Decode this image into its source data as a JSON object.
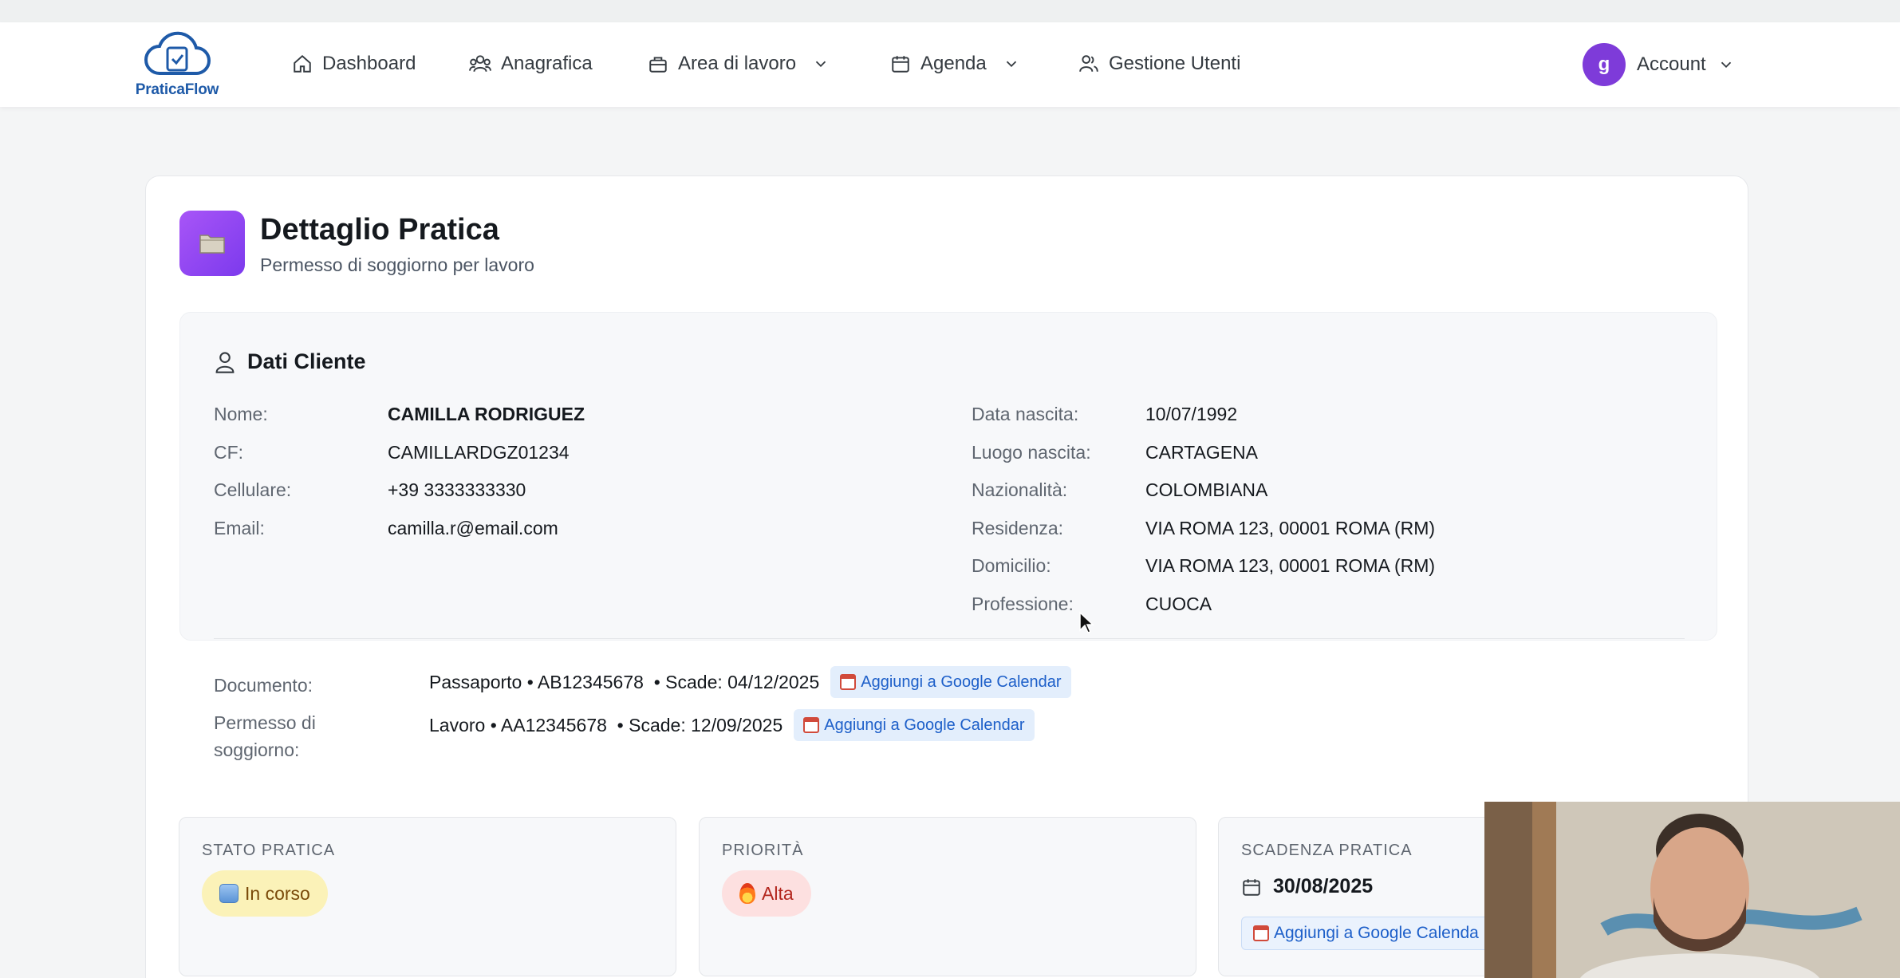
{
  "app": {
    "name": "PraticaFlow"
  },
  "nav": {
    "items": [
      {
        "label": "Dashboard",
        "icon": "home-icon"
      },
      {
        "label": "Anagrafica",
        "icon": "users-icon"
      },
      {
        "label": "Area di lavoro",
        "icon": "briefcase-icon",
        "dropdown": true
      },
      {
        "label": "Agenda",
        "icon": "calendar-icon",
        "dropdown": true
      },
      {
        "label": "Gestione Utenti",
        "icon": "user-group-icon"
      }
    ],
    "account": {
      "avatar_letter": "g",
      "label": "Account"
    }
  },
  "page": {
    "title": "Dettaglio Pratica",
    "subtitle": "Permesso di soggiorno per lavoro"
  },
  "client": {
    "section_title": "Dati Cliente",
    "left": [
      {
        "label": "Nome:",
        "value": "CAMILLA RODRIGUEZ"
      },
      {
        "label": "CF:",
        "value": "CAMILLARDGZ01234"
      },
      {
        "label": "Cellulare:",
        "value": "+39 3333333330"
      },
      {
        "label": "Email:",
        "value": "camilla.r@email.com"
      }
    ],
    "right": [
      {
        "label": "Data nascita:",
        "value": "10/07/1992"
      },
      {
        "label": "Luogo nascita:",
        "value": "CARTAGENA"
      },
      {
        "label": "Nazionalità:",
        "value": "COLOMBIANA"
      },
      {
        "label": "Residenza:",
        "value": "VIA ROMA 123, 00001 ROMA (RM)"
      },
      {
        "label": "Domicilio:",
        "value": "VIA ROMA 123, 00001 ROMA (RM)"
      },
      {
        "label": "Professione:",
        "value": "CUOCA"
      }
    ],
    "documents": [
      {
        "label": "Documento:",
        "value": "Passaporto • AB12345678  • Scade: 04/12/2025",
        "action": "Aggiungi a Google Calendar"
      },
      {
        "label_line1": "Permesso di",
        "label_line2": "soggiorno:",
        "value": "Lavoro • AA12345678  • Scade: 12/09/2025",
        "action": "Aggiungi a Google Calendar"
      }
    ]
  },
  "status": {
    "stato_label": "STATO PRATICA",
    "stato_value": "In corso",
    "priorita_label": "PRIORITÀ",
    "priorita_value": "Alta",
    "scadenza_label": "SCADENZA PRATICA",
    "scadenza_value": "30/08/2025",
    "scadenza_action": "Aggiungi a Google Calenda"
  },
  "colors": {
    "accent": "#7c3aed",
    "link": "#1d5fc9",
    "brand": "#1e5aa8"
  }
}
